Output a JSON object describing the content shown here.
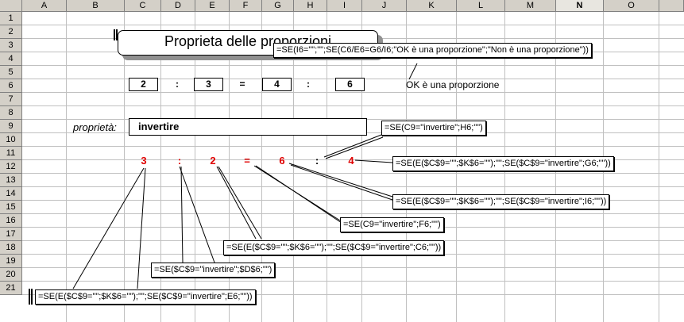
{
  "sheet": {
    "columns": [
      "A",
      "B",
      "C",
      "D",
      "E",
      "F",
      "G",
      "H",
      "I",
      "J",
      "K",
      "L",
      "M",
      "N",
      "O"
    ],
    "active_column": "N",
    "rows": [
      "1",
      "2",
      "3",
      "4",
      "5",
      "6",
      "7",
      "8",
      "9",
      "10",
      "11",
      "12",
      "13",
      "14",
      "15",
      "16",
      "17",
      "18",
      "19",
      "20",
      "21"
    ]
  },
  "title": "Proprieta delle proporzioni",
  "proportion": {
    "a": "2",
    "colon1": ":",
    "b": "3",
    "eq": "=",
    "c": "4",
    "colon2": ":",
    "d": "6"
  },
  "result": "OK è una proporzione",
  "property": {
    "label": "proprietà:",
    "value": "invertire"
  },
  "transformed": {
    "c": "3",
    "d": ":",
    "e": "2",
    "f": "=",
    "g": "6",
    "h": ":",
    "i": "4"
  },
  "formulas": {
    "k6": "=SE(I6=\"\";\"\";SE(C6/E6=G6/I6;\"OK è una proporzione\";\"Non è una proporzione\"))",
    "h11": "=SE(C9=\"invertire\";H6;\"\")",
    "i11": "=SE(E($C$9=\"\";$K$6=\"\");\"\";SE($C$9=\"invertire\";G6;\"\"))",
    "g11": "=SE(E($C$9=\"\";$K$6=\"\");\"\";SE($C$9=\"invertire\";I6;\"\"))",
    "f11": "=SE(C9=\"invertire\";F6;\"\")",
    "e11": "=SE(E($C$9=\"\";$K$6=\"\");\"\";SE($C$9=\"invertire\";C6;\"\"))",
    "d11": "=SE($C$9=\"invertire\";$D$6;\"\")",
    "c11": "=SE(E($C$9=\"\";$K$6=\"\");\"\";SE($C$9=\"invertire\";E6;\"\"))"
  },
  "colors": {
    "header_bg": "#d4d0c8",
    "grid": "#c0c0c0",
    "red_values": "#e00000"
  }
}
